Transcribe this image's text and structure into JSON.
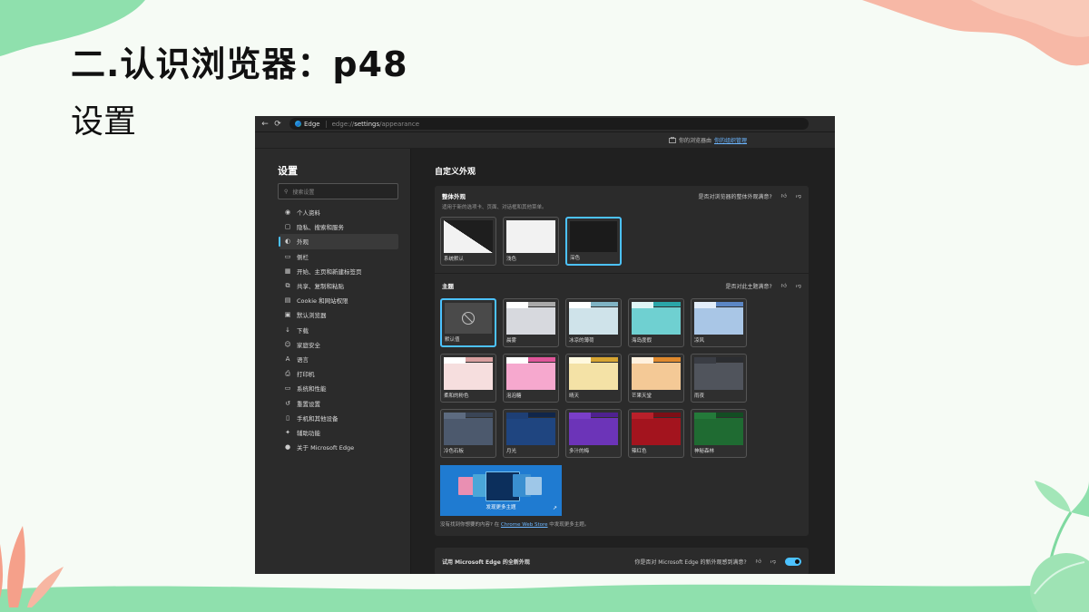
{
  "slide": {
    "title": "二.认识浏览器：p48",
    "subtitle": "设置"
  },
  "colors": {
    "accent": "#4cc2ff",
    "slide_bg": "#f6fbf5",
    "deco_green": "#7fd9a0",
    "deco_pink": "#f5b2a0"
  },
  "browser": {
    "back_icon": "←",
    "refresh_icon": "⟳",
    "tab_label": "Edge",
    "url_prefix": "edge://",
    "url_bold": "settings",
    "url_suffix": "/appearance",
    "managed_text": "你的浏览器由",
    "managed_link": "你的组织管理"
  },
  "sidebar": {
    "title": "设置",
    "search_placeholder": "搜索设置",
    "items": [
      {
        "icon": "person-icon",
        "glyph": "◉",
        "label": "个人资料"
      },
      {
        "icon": "lock-icon",
        "glyph": "▢",
        "label": "隐私、搜索和服务"
      },
      {
        "icon": "appearance-icon",
        "glyph": "◐",
        "label": "外观"
      },
      {
        "icon": "sidebar-icon",
        "glyph": "▭",
        "label": "侧栏"
      },
      {
        "icon": "home-icon",
        "glyph": "▦",
        "label": "开始、主页和新建标签页"
      },
      {
        "icon": "share-icon",
        "glyph": "⧉",
        "label": "共享、复制和粘贴"
      },
      {
        "icon": "cookie-icon",
        "glyph": "▤",
        "label": "Cookie 和网站权限"
      },
      {
        "icon": "browser-icon",
        "glyph": "▣",
        "label": "默认浏览器"
      },
      {
        "icon": "download-icon",
        "glyph": "↓",
        "label": "下载"
      },
      {
        "icon": "family-icon",
        "glyph": "☺",
        "label": "家庭安全"
      },
      {
        "icon": "language-icon",
        "glyph": "A",
        "label": "语言"
      },
      {
        "icon": "printer-icon",
        "glyph": "⎙",
        "label": "打印机"
      },
      {
        "icon": "system-icon",
        "glyph": "▭",
        "label": "系统和性能"
      },
      {
        "icon": "reset-icon",
        "glyph": "↺",
        "label": "重置设置"
      },
      {
        "icon": "phone-icon",
        "glyph": "▯",
        "label": "手机和其他设备"
      },
      {
        "icon": "accessibility-icon",
        "glyph": "✦",
        "label": "辅助功能"
      },
      {
        "icon": "edge-icon",
        "glyph": "●",
        "label": "关于 Microsoft Edge"
      }
    ]
  },
  "main": {
    "title": "自定义外观",
    "overall": {
      "heading": "整体外观",
      "feedback": "是否对浏览器的整体外观满意?",
      "description": "适用于新的选项卡、页面、对话框和其他菜单。",
      "options": [
        {
          "label": "系统默认",
          "kind": "system"
        },
        {
          "label": "浅色",
          "kind": "light"
        },
        {
          "label": "深色",
          "kind": "dark",
          "selected": true
        }
      ]
    },
    "theme": {
      "heading": "主题",
      "feedback": "是否对此主题满意?",
      "items": [
        {
          "label": "默认值",
          "selected": true,
          "default": true
        },
        {
          "label": "晨雾",
          "tab": "#ffffff",
          "strip": "#a9a9a9",
          "body": "#d7d9de"
        },
        {
          "label": "冰凉的薄荷",
          "tab": "#ffffff",
          "strip": "#7fb3c4",
          "body": "#cfe3ea"
        },
        {
          "label": "海岛度假",
          "tab": "#dff5f5",
          "strip": "#2aa6a8",
          "body": "#6fd0d1"
        },
        {
          "label": "凉风",
          "tab": "#e3eefa",
          "strip": "#5b86c4",
          "body": "#a9c6e6"
        },
        {
          "label": "柔和的粉色",
          "tab": "#ffffff",
          "strip": "#d9a0a0",
          "body": "#f6dede"
        },
        {
          "label": "泡泡糖",
          "tab": "#ffffff",
          "strip": "#e0569a",
          "body": "#f6a8ce"
        },
        {
          "label": "晴天",
          "tab": "#fff9df",
          "strip": "#d7a532",
          "body": "#f4e2a6"
        },
        {
          "label": "芒果天堂",
          "tab": "#fff1df",
          "strip": "#e08a2e",
          "body": "#f4c996"
        },
        {
          "label": "雨夜",
          "tab": "#3a3d44",
          "strip": "#2b2d31",
          "body": "#50545c"
        },
        {
          "label": "冷色石板",
          "tab": "#5d6b80",
          "strip": "#3a4556",
          "body": "#4c596d"
        },
        {
          "label": "月光",
          "tab": "#1e3f75",
          "strip": "#10264a",
          "body": "#1f4580"
        },
        {
          "label": "多汁的梅",
          "tab": "#7a3ec8",
          "strip": "#4f2190",
          "body": "#6c34b8"
        },
        {
          "label": "辣红色",
          "tab": "#b8202a",
          "strip": "#7d0f16",
          "body": "#a3141e"
        },
        {
          "label": "神秘森林",
          "tab": "#247a3a",
          "strip": "#134d23",
          "body": "#1f6b32"
        }
      ],
      "promo_label": "发现更多主题",
      "note_prefix": "没有找到你想要的内容? 在",
      "note_link": "Chrome Web Store",
      "note_suffix": "中发现更多主题。"
    },
    "new_look": {
      "label": "试用 Microsoft Edge 的全新外观",
      "feedback": "你是否对 Microsoft Edge 的新外观感到满意?",
      "toggle_on": true
    },
    "thumbs_up": "👍︎",
    "thumbs_down": "👎︎"
  }
}
